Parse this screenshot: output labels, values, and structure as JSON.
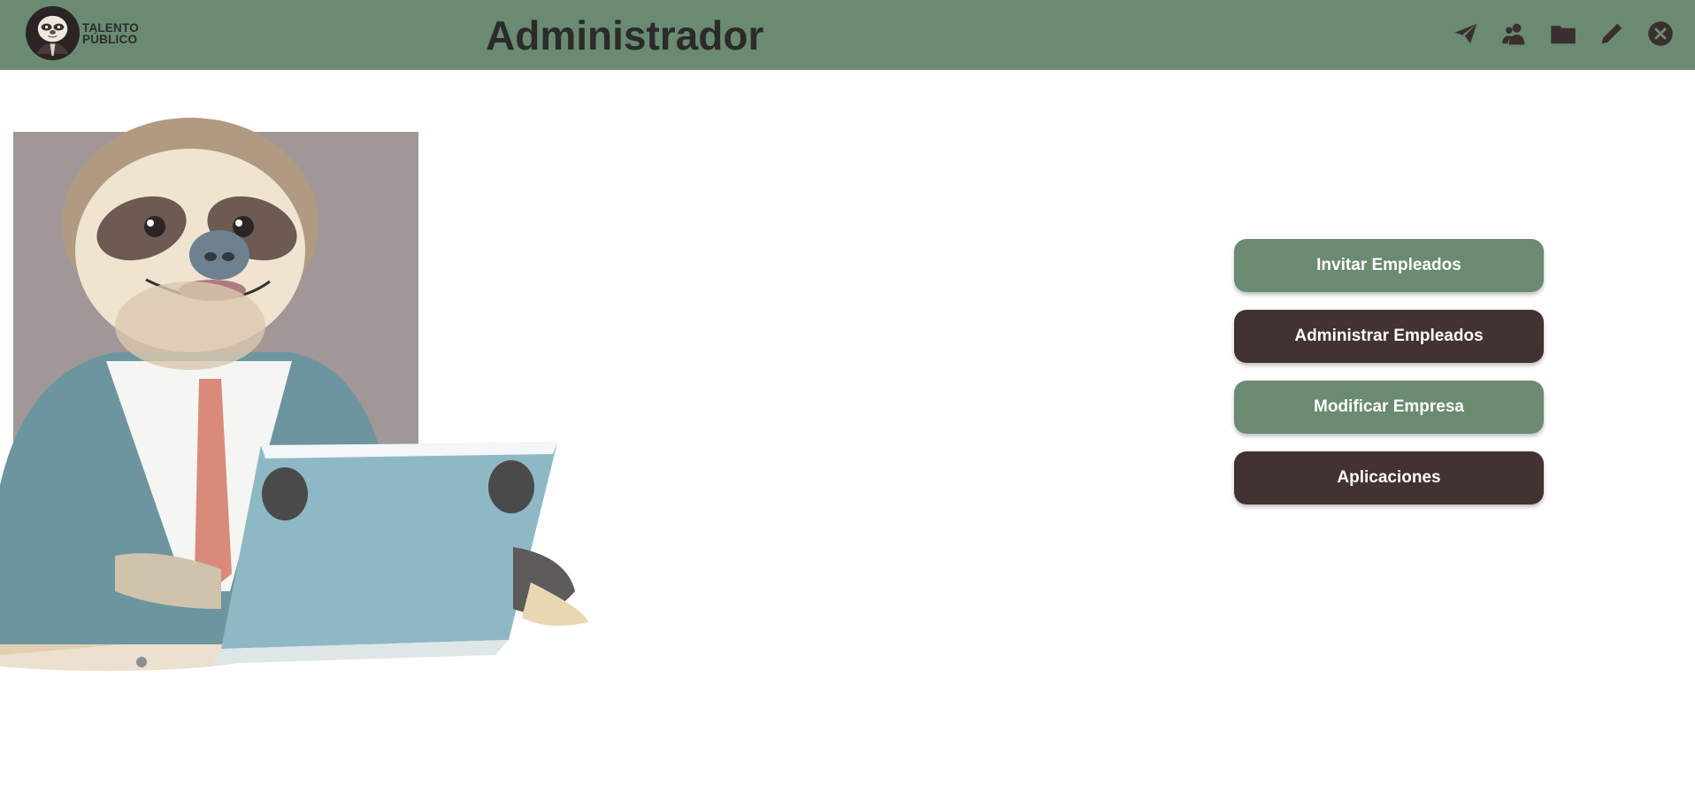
{
  "header": {
    "logo_line1": "TALENTO",
    "logo_line2": "PÚBLICO",
    "title": "Administrador",
    "icons": [
      "send-icon",
      "users-icon",
      "folder-icon",
      "edit-icon",
      "close-icon"
    ]
  },
  "actions": [
    {
      "label": "Invitar Empleados",
      "variant": "green"
    },
    {
      "label": "Administrar Empleados",
      "variant": "brown"
    },
    {
      "label": "Modificar Empresa",
      "variant": "green"
    },
    {
      "label": "Aplicaciones",
      "variant": "brown"
    }
  ],
  "colors": {
    "header_bg": "#6b8a72",
    "green": "#6b8a72",
    "brown": "#433232",
    "icon": "#3b2e2e"
  }
}
